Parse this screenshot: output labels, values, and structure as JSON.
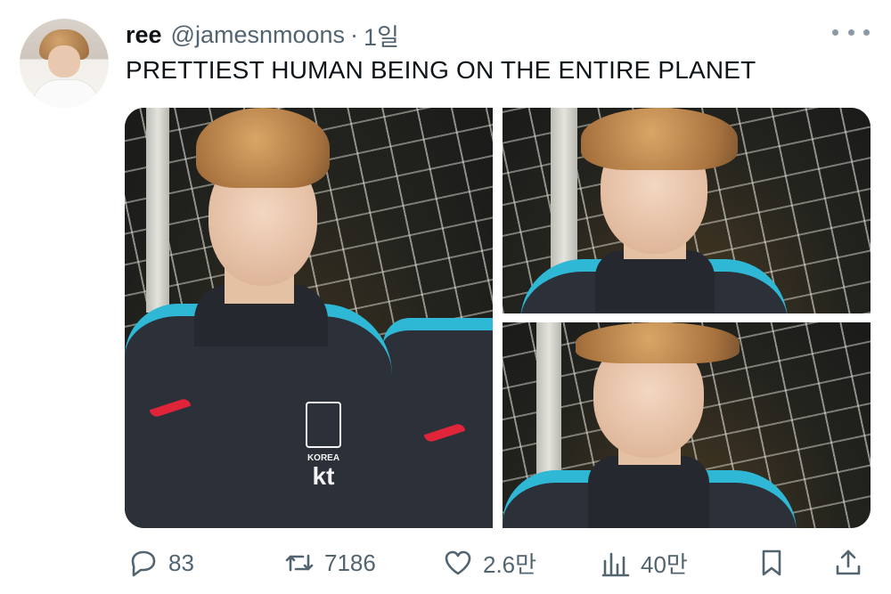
{
  "tweet": {
    "author_name": "ree",
    "author_handle": "@jamesnmoons",
    "separator": "·",
    "time": "1일",
    "text": "PRETTIEST HUMAN BEING ON THE ENTIRE PLANET"
  },
  "media": {
    "photos": [
      {
        "badge_text": "KOREA",
        "badge_brand": "kt"
      },
      {},
      {}
    ]
  },
  "actions": {
    "reply": {
      "icon": "reply-icon",
      "count": "83"
    },
    "retweet": {
      "icon": "retweet-icon",
      "count": "7186"
    },
    "like": {
      "icon": "heart-icon",
      "count": "2.6만"
    },
    "views": {
      "icon": "views-chart-icon",
      "count": "40만"
    },
    "bookmark": {
      "icon": "bookmark-icon"
    },
    "share": {
      "icon": "share-icon"
    }
  },
  "colors": {
    "text_primary": "#0f1419",
    "text_secondary": "#536471",
    "jacket_accent": "#2fb7d6",
    "swoosh": "#e0253a"
  }
}
